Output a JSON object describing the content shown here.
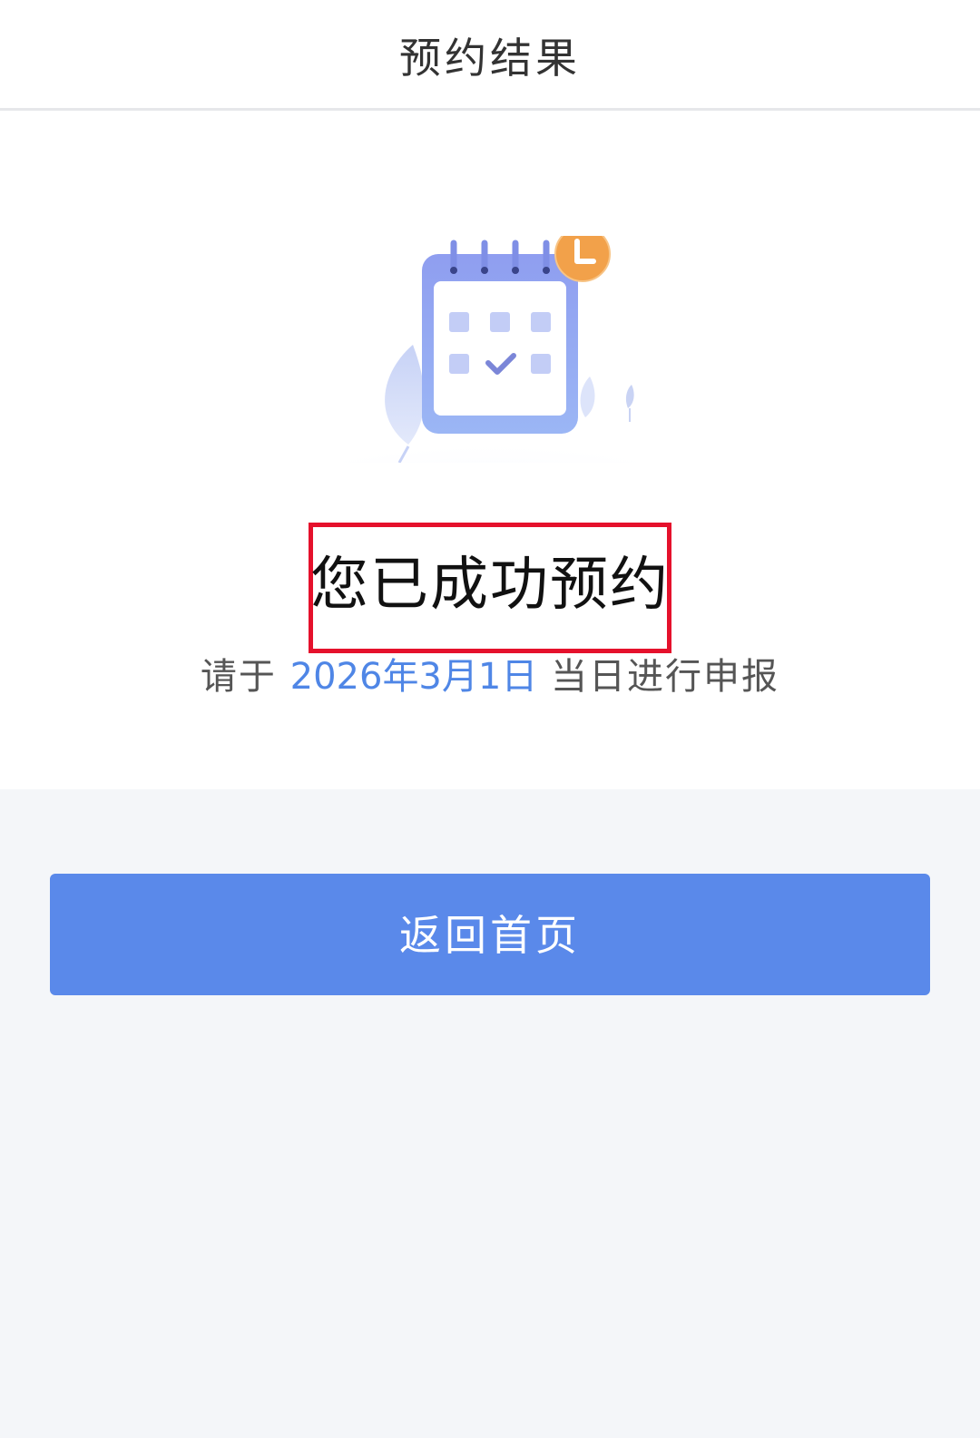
{
  "nav": {
    "title": "预约结果"
  },
  "result": {
    "headline": "您已成功预约",
    "subline_prefix": "请于 ",
    "date": "2026年3月1日",
    "subline_suffix": " 当日进行申报",
    "illustration_icon": "calendar-clock-icon"
  },
  "actions": {
    "home_label": "返回首页"
  },
  "colors": {
    "accent": "#5a89ea",
    "date_text": "#4f86e6",
    "highlight_border": "#e5112c",
    "clock_badge": "#f2a14a",
    "background": "#f4f6f9"
  }
}
